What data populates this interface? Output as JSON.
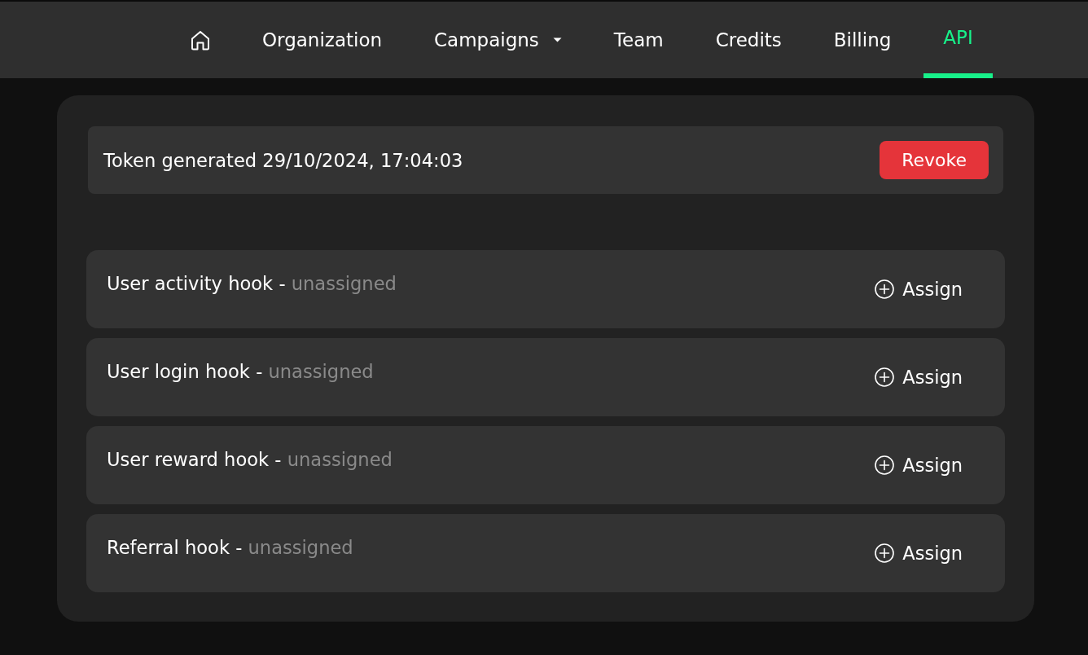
{
  "nav": {
    "items": [
      {
        "kind": "home",
        "selected": false
      },
      {
        "kind": "link",
        "label": "Organization",
        "selected": false
      },
      {
        "kind": "menu",
        "label": "Campaigns",
        "selected": false
      },
      {
        "kind": "link",
        "label": "Team",
        "selected": false
      },
      {
        "kind": "link",
        "label": "Credits",
        "selected": false
      },
      {
        "kind": "link",
        "label": "Billing",
        "selected": false
      },
      {
        "kind": "link",
        "label": "API",
        "selected": true
      }
    ]
  },
  "token": {
    "text": "Token generated 29/10/2024, 17:04:03",
    "button": "Revoke"
  },
  "hooks": [
    {
      "label": "User activity hook -",
      "status": "unassigned",
      "button": "Assign"
    },
    {
      "label": "User login hook -",
      "status": "unassigned",
      "button": "Assign"
    },
    {
      "label": "User reward hook -",
      "status": "unassigned",
      "button": "Assign"
    },
    {
      "label": "Referral hook -",
      "status": "unassigned",
      "button": "Assign"
    }
  ]
}
